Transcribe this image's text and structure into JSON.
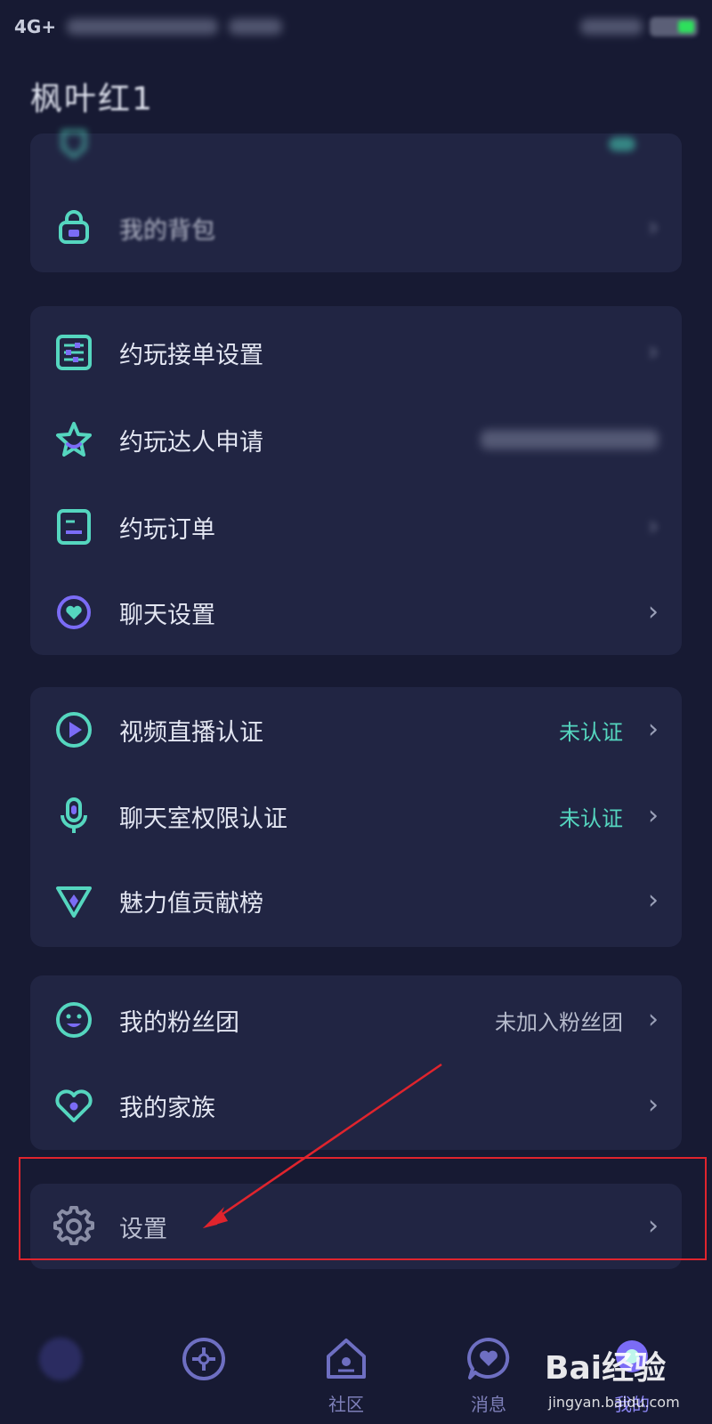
{
  "status_bar": {
    "network": "4G+"
  },
  "profile": {
    "username": "枫叶红1"
  },
  "cards": [
    {
      "items": [
        {
          "label": "",
          "icon": "shield-icon",
          "value": ""
        },
        {
          "label": "我的背包",
          "icon": "backpack-icon",
          "value": ""
        }
      ]
    },
    {
      "items": [
        {
          "label": "约玩接单设置",
          "icon": "sliders-icon",
          "value": ""
        },
        {
          "label": "约玩达人申请",
          "icon": "star-icon",
          "value": ""
        },
        {
          "label": "约玩订单",
          "icon": "order-icon",
          "value": ""
        },
        {
          "label": "聊天设置",
          "icon": "chat-heart-icon",
          "value": ""
        }
      ]
    },
    {
      "items": [
        {
          "label": "视频直播认证",
          "icon": "play-icon",
          "value": "未认证"
        },
        {
          "label": "聊天室权限认证",
          "icon": "microphone-icon",
          "value": "未认证"
        },
        {
          "label": "魅力值贡献榜",
          "icon": "diamond-triangle-icon",
          "value": ""
        }
      ]
    },
    {
      "items": [
        {
          "label": "我的粉丝团",
          "icon": "smiley-icon",
          "value": "未加入粉丝团"
        },
        {
          "label": "我的家族",
          "icon": "heart-icon",
          "value": ""
        }
      ]
    },
    {
      "items": [
        {
          "label": "设置",
          "icon": "gear-icon",
          "value": ""
        }
      ]
    }
  ],
  "tabs": [
    {
      "label": "",
      "icon": "home-circle-icon"
    },
    {
      "label": "",
      "icon": "compass-icon"
    },
    {
      "label": "社区",
      "icon": "community-house-icon"
    },
    {
      "label": "消息",
      "icon": "message-heart-icon"
    },
    {
      "label": "我的",
      "icon": "profile-icon"
    }
  ],
  "watermark": {
    "logo": "Bai经验",
    "url": "jingyan.baidu.com"
  },
  "colors": {
    "background": "#171a33",
    "card": "#212543",
    "accent_teal": "#55d6bf",
    "accent_purple": "#7b6cf6",
    "highlight_red": "#e0242d"
  }
}
